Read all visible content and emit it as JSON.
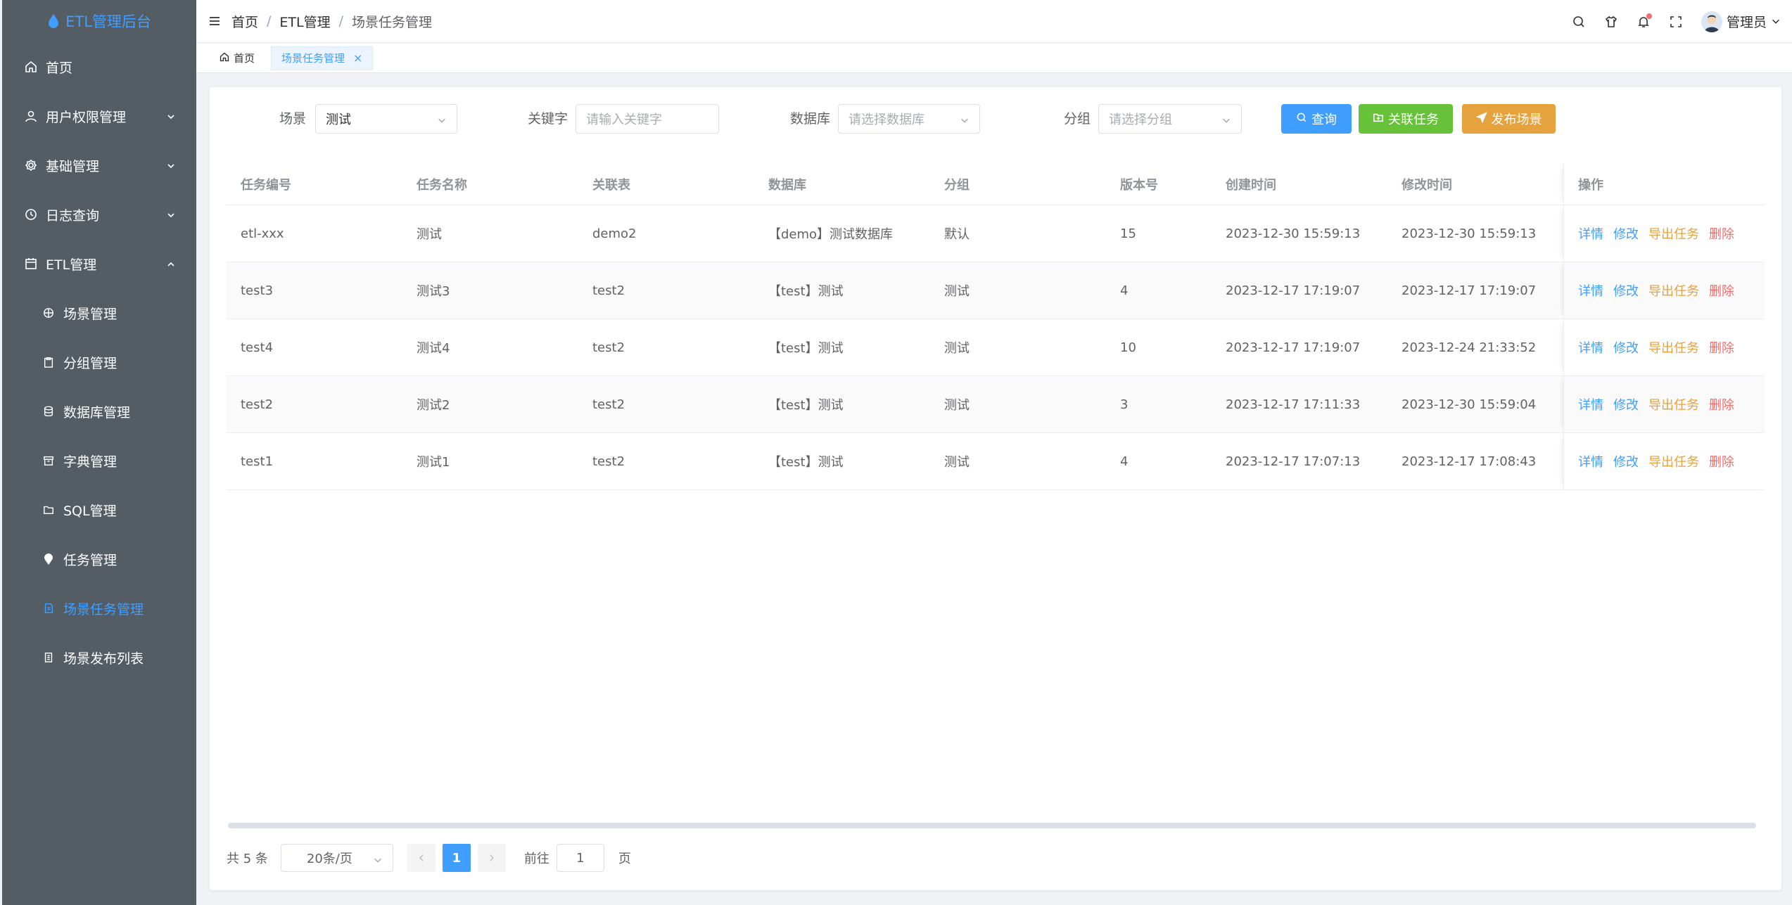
{
  "app": {
    "title": "ETL管理后台"
  },
  "sidebar": {
    "items": [
      {
        "label": "首页",
        "icon": "home-icon"
      },
      {
        "label": "用户权限管理",
        "icon": "user-icon",
        "expandable": true
      },
      {
        "label": "基础管理",
        "icon": "gear-icon",
        "expandable": true
      },
      {
        "label": "日志查询",
        "icon": "clock-icon",
        "expandable": true
      },
      {
        "label": "ETL管理",
        "icon": "calendar-icon",
        "expandable": true,
        "expanded": true
      }
    ],
    "subitems": [
      {
        "label": "场景管理",
        "icon": "globe-icon"
      },
      {
        "label": "分组管理",
        "icon": "clipboard-icon"
      },
      {
        "label": "数据库管理",
        "icon": "database-icon"
      },
      {
        "label": "字典管理",
        "icon": "box-icon"
      },
      {
        "label": "SQL管理",
        "icon": "folder-icon"
      },
      {
        "label": "任务管理",
        "icon": "pin-icon"
      },
      {
        "label": "场景任务管理",
        "icon": "document-icon",
        "active": true
      },
      {
        "label": "场景发布列表",
        "icon": "list-icon"
      }
    ]
  },
  "header": {
    "breadcrumb": [
      "首页",
      "ETL管理",
      "场景任务管理"
    ],
    "separator": "/",
    "user_name": "管理员"
  },
  "tags": [
    {
      "label": "首页",
      "icon": "home-icon"
    },
    {
      "label": "场景任务管理",
      "active": true,
      "close": "×"
    }
  ],
  "filters": {
    "scene_label": "场景",
    "scene_value": "测试",
    "keyword_label": "关键字",
    "keyword_placeholder": "请输入关键字",
    "database_label": "数据库",
    "database_placeholder": "请选择数据库",
    "group_label": "分组",
    "group_placeholder": "请选择分组",
    "search_button": "查询",
    "link_button": "关联任务",
    "publish_button": "发布场景"
  },
  "table": {
    "columns": [
      "任务编号",
      "任务名称",
      "关联表",
      "数据库",
      "分组",
      "版本号",
      "创建时间",
      "修改时间",
      "操作"
    ],
    "rows": [
      [
        "etl-xxx",
        "测试",
        "demo2",
        "【demo】测试数据库",
        "默认",
        "15",
        "2023-12-30 15:59:13",
        "2023-12-30 15:59:13"
      ],
      [
        "test3",
        "测试3",
        "test2",
        "【test】测试",
        "测试",
        "4",
        "2023-12-17 17:19:07",
        "2023-12-17 17:19:07"
      ],
      [
        "test4",
        "测试4",
        "test2",
        "【test】测试",
        "测试",
        "10",
        "2023-12-17 17:19:07",
        "2023-12-24 21:33:52"
      ],
      [
        "test2",
        "测试2",
        "test2",
        "【test】测试",
        "测试",
        "3",
        "2023-12-17 17:11:33",
        "2023-12-30 15:59:04"
      ],
      [
        "test1",
        "测试1",
        "test2",
        "【test】测试",
        "测试",
        "4",
        "2023-12-17 17:07:13",
        "2023-12-17 17:08:43"
      ]
    ],
    "actions": {
      "detail": "详情",
      "edit": "修改",
      "export": "导出任务",
      "delete": "删除"
    }
  },
  "pagination": {
    "total": "共 5 条",
    "page_size": "20条/页",
    "current_page": "1",
    "goto_label": "前往",
    "goto_value": "1",
    "page_word": "页"
  },
  "colors": {
    "primary": "#409eff",
    "success": "#67c23a",
    "warning": "#e6a23c",
    "danger": "#f56c6c",
    "sidebar": "#545c64"
  }
}
